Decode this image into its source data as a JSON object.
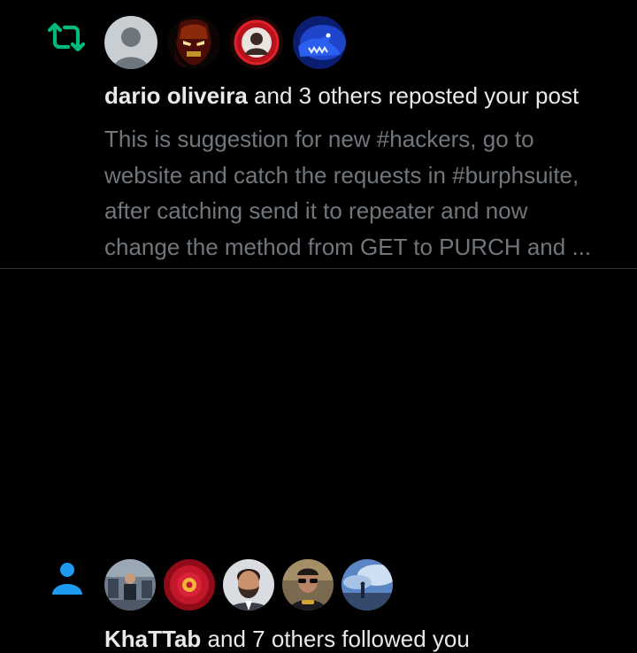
{
  "colors": {
    "background": "#000000",
    "primary_text": "#e7e9ea",
    "secondary_text": "#71767b",
    "repost_green": "#00ba7c",
    "follow_blue": "#1d9bf0",
    "divider": "#2f3336"
  },
  "notifications": [
    {
      "type": "repost",
      "icon": "repost-icon",
      "avatars": [
        "default-avatar",
        "iron-man-avatar",
        "red-portrait-avatar",
        "blue-creature-avatar"
      ],
      "actor": "dario oliveira",
      "action": "and 3 others reposted your post",
      "preview_lines": [
        "This is suggestion for new #hackers, go to",
        "website and catch the requests in #burphsuite,",
        "after catching send it to repeater and now",
        "change the method from GET to PURCH and ..."
      ]
    },
    {
      "type": "follow",
      "icon": "person-icon",
      "avatars": [
        "conference-avatar",
        "red-rose-avatar",
        "man-portrait-avatar",
        "sunglasses-avatar",
        "sky-landscape-avatar"
      ],
      "actor": "KhaTTab",
      "action": "and 7 others followed you"
    }
  ]
}
